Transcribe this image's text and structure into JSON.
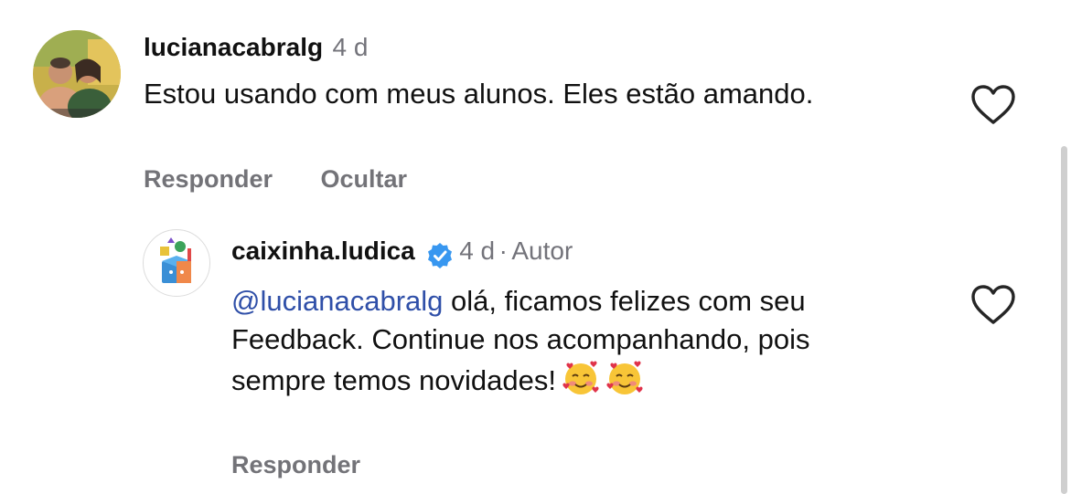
{
  "comments": [
    {
      "username": "lucianacabralg",
      "time": "4 d",
      "text": "Estou usando com meus alunos. Eles estão amando.",
      "actions": {
        "reply": "Responder",
        "hide": "Ocultar"
      },
      "avatar_icon": "profile-photo"
    },
    {
      "username": "caixinha.ludica",
      "time": "4 d",
      "separator": "·",
      "author_label": "Autor",
      "mention": "@lucianacabralg",
      "text": "olá, ficamos felizes com seu Feedback. Continue nos acompanhando, pois sempre temos novidades!",
      "emojis": [
        "smiling-face-with-hearts",
        "smiling-face-with-hearts"
      ],
      "actions": {
        "reply": "Responder"
      },
      "verified_icon": "verified-badge-icon",
      "avatar_icon": "colorful-box-logo"
    }
  ],
  "colors": {
    "mention": "#2f4fa8",
    "verified": "#3897f0",
    "secondary_text": "#737378"
  }
}
